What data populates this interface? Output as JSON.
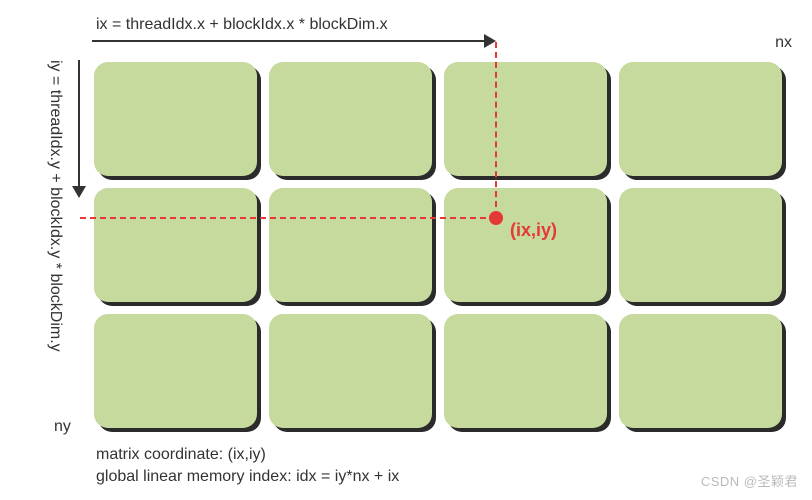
{
  "axes": {
    "ix_formula": "ix = threadIdx.x + blockIdx.x * blockDim.x",
    "iy_formula": "iy = threadIdx.y + blockIdx.y * blockDim.y",
    "nx_label": "nx",
    "ny_label": "ny"
  },
  "point": {
    "label": "(ix,iy)"
  },
  "captions": {
    "coord": "matrix coordinate: (ix,iy)",
    "index": "global linear memory index: idx = iy*nx + ix"
  },
  "grid": {
    "rows": 3,
    "cols": 4
  },
  "colors": {
    "block_fill": "#c6da9e",
    "accent": "#e53935"
  },
  "watermark": "CSDN @圣颖君"
}
